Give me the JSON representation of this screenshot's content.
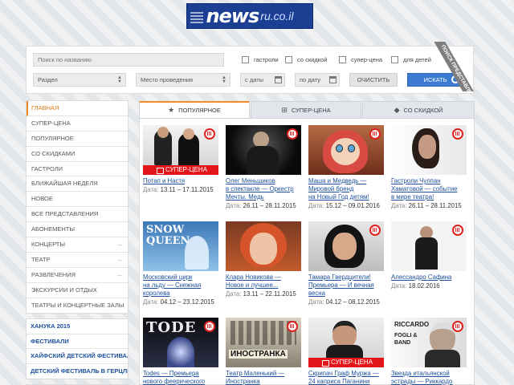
{
  "logo": {
    "main": "news",
    "suffix": "ru.co.il"
  },
  "search": {
    "placeholder": "Поиск по названию",
    "checkboxes": [
      "гастроли",
      "со скидкой",
      "супер-цена",
      "для детей"
    ],
    "section": "Раздел",
    "venue": "Место проведения",
    "date_from": "с даты",
    "date_to": "по дату",
    "clear": "ОЧИСТИТЬ",
    "submit": "ИСКАТЬ",
    "ribbon": "ПОИСК ПРЕДСТАВЛЕНИЙ"
  },
  "menu": [
    "ГЛАВНАЯ",
    "СУПЕР-ЦЕНА",
    "ПОПУЛЯРНОЕ",
    "СО СКИДКАМИ",
    "ГАСТРОЛИ",
    "БЛИЖАЙШАЯ НЕДЕЛЯ",
    "НОВОЕ",
    "ВСЕ ПРЕДСТАВЛЕНИЯ",
    "АБОНЕМЕНТЫ",
    "КОНЦЕРТЫ",
    "ТЕАТР",
    "РАЗВЛЕЧЕНИЯ",
    "ЭКСКУРСИИ И ОТДЫХ",
    "ТЕАТРЫ И КОНЦЕРТНЫЕ ЗАЛЫ"
  ],
  "promo": [
    "ХАНУКА 2015",
    "ФЕСТИВАЛИ",
    "ХАЙФСКИЙ ДЕТСКИЙ ФЕСТИВАЛЬ",
    "ДЕТСКИЙ ФЕСТИВАЛЬ В ГЕРЦЛИИ"
  ],
  "tabs": [
    "ПОПУЛЯРНОЕ",
    "СУПЕР-ЦЕНА",
    "СО СКИДКОЙ"
  ],
  "date_label": "Дата:",
  "sale_label": "СУПЕР-ЦЕНА",
  "cards": [
    {
      "title1": "Потап и Настя",
      "title2": "",
      "title3": "",
      "date": "13.11 – 17.11.2015"
    },
    {
      "title1": "Олег Меньшиков",
      "title2": "в спектакле — Оркестр",
      "title3": "Мечты. Медь",
      "date": "26.11 – 28.11.2015"
    },
    {
      "title1": "Маша и Медведь —",
      "title2": "Мировой бренд",
      "title3": "на Новый Год детям!",
      "date": "15.12 – 09.01.2016"
    },
    {
      "title1": "Гастроли Чулпан",
      "title2": "Хаматовой — событие",
      "title3": "в мире театра!",
      "date": "26.11 – 28.11.2015"
    },
    {
      "title1": "Московский цирк",
      "title2": "на льду — Снежная",
      "title3": "королева",
      "date": "04.12 – 23.12.2015"
    },
    {
      "title1": "Клара Новикова —",
      "title2": "Новое и лучшее...",
      "title3": "",
      "date": "13.11 – 22.11.2015"
    },
    {
      "title1": "Тамара Гвердцители!",
      "title2": "Премьера — И вечная",
      "title3": "весна",
      "date": "04.12 – 08.12.2015"
    },
    {
      "title1": "Алессандро Сафина",
      "title2": "",
      "title3": "",
      "date": "18.02.2016"
    },
    {
      "title1": "Todes — Премьера",
      "title2": "нового феерического",
      "title3": "",
      "date": ""
    },
    {
      "title1": "Театр Маленький —",
      "title2": "Иностранка",
      "title3": "",
      "date": ""
    },
    {
      "title1": "Скрипач Граф Муржа —",
      "title2": "24 каприса Паганини",
      "title3": "",
      "date": ""
    },
    {
      "title1": "Звезда итальянской",
      "title2": "эстрады — Риккардо",
      "title3": "",
      "date": ""
    }
  ],
  "posters": {
    "snow": "SNOW QUEEN",
    "todes": "TODE",
    "inostranka": "ИНОСТРАНКА",
    "riccardo": "RICCARDO",
    "fogli": "FOGLI & BAND"
  }
}
